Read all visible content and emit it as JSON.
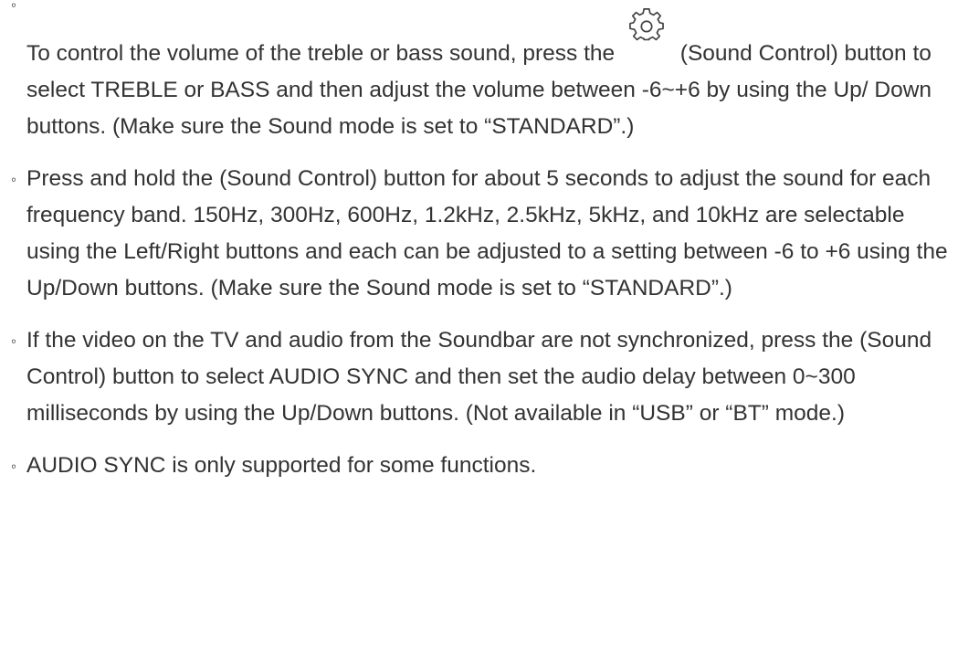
{
  "bullet_char": "◦",
  "items": [
    {
      "text_before_icon": "To control the volume of the treble or bass sound, press the",
      "icon": "gear-icon",
      "text_after_icon": "(Sound Control) button to select TREBLE or BASS and then adjust the volume between -6~+6 by using the Up/ Down buttons. (Make sure the Sound mode is set to “STANDARD”.)"
    },
    {
      "text": "Press and hold the (Sound Control) button for about 5 seconds to adjust the sound for each frequency band. 150Hz, 300Hz, 600Hz, 1.2kHz, 2.5kHz, 5kHz, and 10kHz are selectable using the Left/Right buttons and each can be adjusted to a setting between -6 to +6 using the Up/Down buttons. (Make sure the Sound mode is set to “STANDARD”.)"
    },
    {
      "text": "If the video on the TV and audio from the Soundbar are not synchronized, press the (Sound Control) button to select AUDIO SYNC and then set the audio delay between 0~300 milliseconds by using the Up/Down buttons. (Not available in “USB” or “BT” mode.)"
    },
    {
      "text": "AUDIO SYNC is only supported for some functions."
    }
  ]
}
